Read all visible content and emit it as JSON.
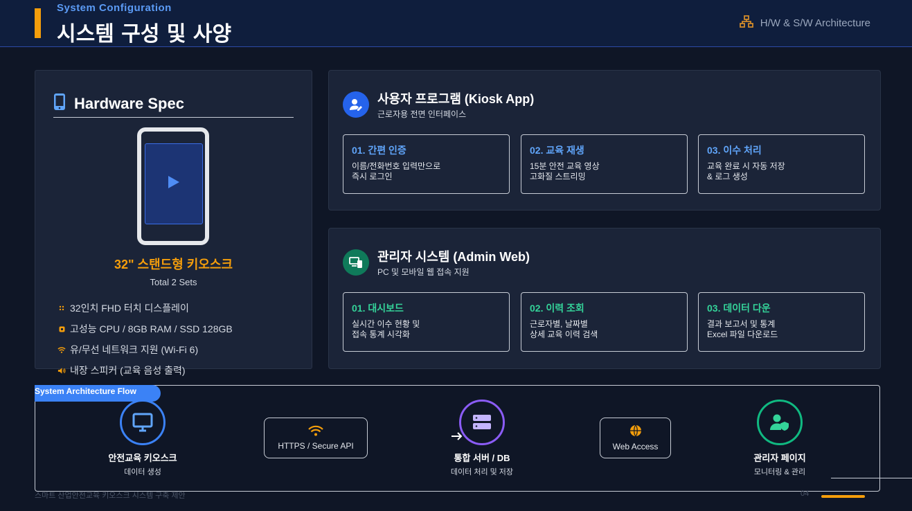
{
  "header": {
    "subtitle": "System Configuration",
    "title": "시스템 구성 및 사양",
    "right_label": "H/W & S/W Architecture",
    "right_icon": "network-icon"
  },
  "hardware": {
    "heading": "Hardware Spec",
    "heading_icon": "tablet-icon",
    "product_name": "32\" 스탠드형 키오스크",
    "sets": "Total 2 Sets",
    "specs": [
      {
        "icon": "display-dots-icon",
        "text": "32인치 FHD 터치 디스플레이"
      },
      {
        "icon": "chip-icon",
        "text": "고성능 CPU / 8GB RAM / SSD 128GB"
      },
      {
        "icon": "wifi-icon",
        "text": "유/무선 네트워크 지원 (Wi-Fi 6)"
      },
      {
        "icon": "speaker-icon",
        "text": "내장 스피커 (교육 음성 출력)"
      }
    ]
  },
  "kiosk_app": {
    "title": "사용자 프로그램 (Kiosk App)",
    "desc": "근로자용 전면 인터페이스",
    "accent": "#60a5fa",
    "badge_color": "#2563eb",
    "cards": [
      {
        "title": "01. 간편 인증",
        "desc": "이름/전화번호 입력만으로\n즉시 로그인"
      },
      {
        "title": "02. 교육 재생",
        "desc": "15분 안전 교육 영상\n고화질 스트리밍"
      },
      {
        "title": "03. 이수 처리",
        "desc": "교육 완료 시 자동 저장\n& 로그 생성"
      }
    ]
  },
  "admin_web": {
    "title": "관리자 시스템 (Admin Web)",
    "desc": "PC 및 모바일 웹 접속 지원",
    "accent": "#34d399",
    "badge_color": "#0f7a5a",
    "cards": [
      {
        "title": "01. 대시보드",
        "desc": "실시간 이수 현황 및\n접속 통계 시각화"
      },
      {
        "title": "02. 이력 조회",
        "desc": "근로자별, 날짜별\n상세 교육 이력 검색"
      },
      {
        "title": "03. 데이터 다운",
        "desc": "결과 보고서 및 통계\nExcel 파일 다운로드"
      }
    ]
  },
  "flow": {
    "tag": "System Architecture Flow",
    "nodes": [
      {
        "title": "안전교육 키오스크",
        "sub": "데이터 생성",
        "icon": "monitor-icon",
        "color": "#3b82f6"
      },
      {
        "title": "통합 서버 / DB",
        "sub": "데이터 처리 및 저장",
        "icon": "server-icon",
        "color": "#8b5cf6"
      },
      {
        "title": "관리자 페이지",
        "sub": "모니터링 & 관리",
        "icon": "user-shield-icon",
        "color": "#10b981"
      }
    ],
    "links": [
      {
        "label": "HTTPS / Secure API",
        "icon": "wifi-icon"
      },
      {
        "label": "Web Access",
        "icon": "globe-icon"
      }
    ]
  },
  "footer": {
    "left": "스마트 산업안전교육 키오스크 시스템 구축 제안",
    "page": "04"
  }
}
